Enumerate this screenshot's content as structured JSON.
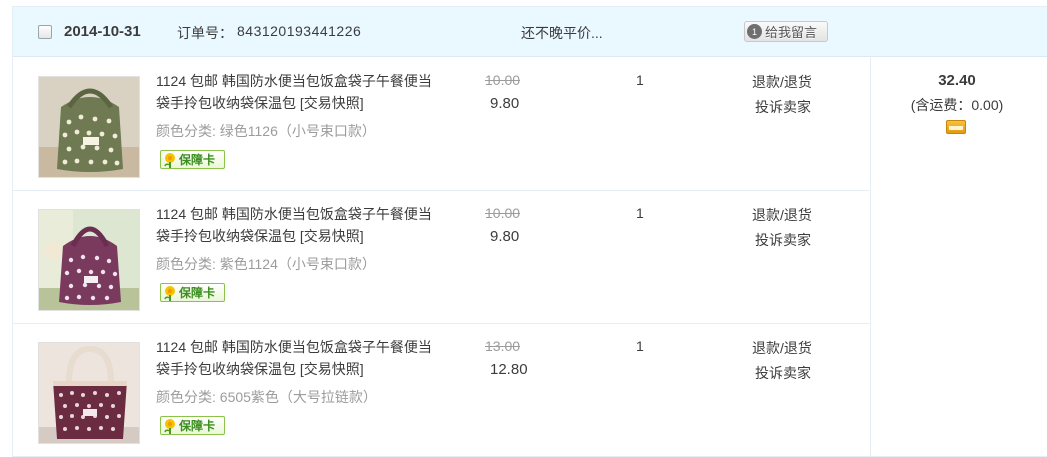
{
  "order": {
    "date": "2014-10-31",
    "order_no_label": "订单号：",
    "order_no": "843120193441226",
    "shop_name": "还不晚平价...",
    "message_button": "给我留言",
    "message_count": "1"
  },
  "items": [
    {
      "title": "1124 包邮 韩国防水便当包饭盒袋子午餐便当袋手拎包收纳袋保温包 [交易快照]",
      "sku": "颜色分类: 绿色1126（小号束口款）",
      "badge": "保障卡",
      "price_original": "10.00",
      "price_now": "9.80",
      "quantity": "1",
      "action_refund": "退款/退货",
      "action_complain": "投诉卖家",
      "bag_color": "#6f7a52"
    },
    {
      "title": "1124 包邮 韩国防水便当包饭盒袋子午餐便当袋手拎包收纳袋保温包 [交易快照]",
      "sku": "颜色分类: 紫色1124（小号束口款）",
      "badge": "保障卡",
      "price_original": "10.00",
      "price_now": "9.80",
      "quantity": "1",
      "action_refund": "退款/退货",
      "action_complain": "投诉卖家",
      "bag_color": "#7a3a5e"
    },
    {
      "title": "1124 包邮 韩国防水便当包饭盒袋子午餐便当袋手拎包收纳袋保温包 [交易快照]",
      "sku": "颜色分类: 6505紫色（大号拉链款）",
      "badge": "保障卡",
      "price_original": "13.00",
      "price_now": "12.80",
      "quantity": "1",
      "action_refund": "退款/退货",
      "action_complain": "投诉卖家",
      "bag_color": "#6b2c42"
    }
  ],
  "total": {
    "amount": "32.40",
    "shipping": "(含运费：0.00)"
  },
  "icons": {
    "checkbox": "checkbox-icon",
    "message": "message-count-icon",
    "badge": "flower-badge-icon",
    "payment": "payment-card-icon"
  }
}
